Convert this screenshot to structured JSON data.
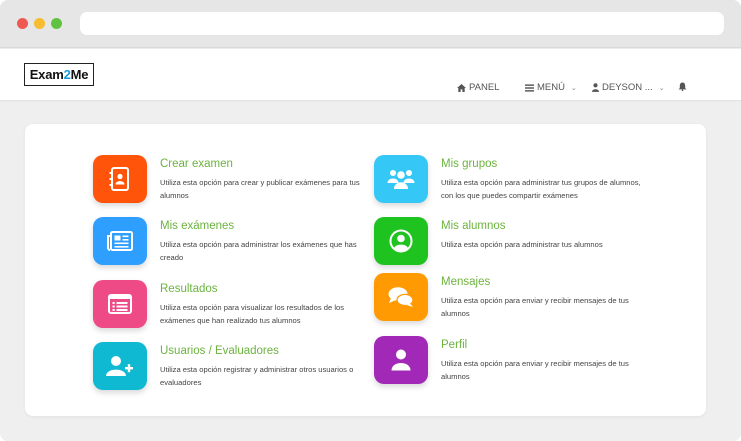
{
  "logo": {
    "prefix": "Exam",
    "highlight": "2",
    "suffix": "Me"
  },
  "navbar": {
    "panel_label": "PANEL",
    "menu_label": "MENÚ",
    "user_label": "DEYSON ..."
  },
  "options": [
    {
      "title": "Crear examen",
      "desc": "Utiliza esta opción para crear y publicar exámenes para tus alumnos",
      "color": "#ff5409",
      "icon": "address-book-icon"
    },
    {
      "title": "Mis exámenes",
      "desc": "Utiliza esta opción para administrar los exámenes que has creado",
      "color": "#2f9fff",
      "icon": "newspaper-icon"
    },
    {
      "title": "Resultados",
      "desc": "Utiliza esta opción para visualizar los resultados de los exámenes que han realizado tus alumnos",
      "color": "#ee4a86",
      "icon": "list-card-icon"
    },
    {
      "title": "Usuarios / Evaluadores",
      "desc": "Utiliza esta opción registrar y administrar otros usuarios o evaluadores",
      "color": "#10b9d2",
      "icon": "user-plus-icon"
    },
    {
      "title": "Mis grupos",
      "desc": "Utiliza esta opción para administrar tus grupos de alumnos, con los que puedes compartir exámenes",
      "color": "#35c7f5",
      "icon": "group-icon"
    },
    {
      "title": "Mis alumnos",
      "desc": "Utiliza esta opción para administrar tus alumnos",
      "color": "#1fc31f",
      "icon": "user-circle-icon"
    },
    {
      "title": "Mensajes",
      "desc": "Utiliza esta opción para enviar y recibir mensajes de tus alumnos",
      "color": "#ff9a03",
      "icon": "comments-icon"
    },
    {
      "title": "Perfil",
      "desc": "Utiliza esta opción para enviar y recibir mensajes de tus alumnos",
      "color": "#a229b8",
      "icon": "user-icon"
    }
  ]
}
